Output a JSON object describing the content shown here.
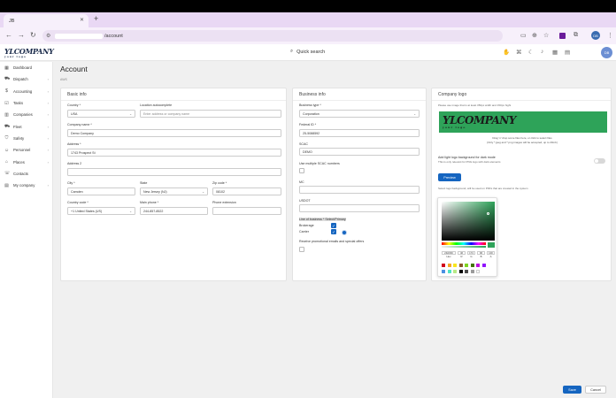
{
  "browser": {
    "tab_title": "JB",
    "url_path": "/account",
    "profile_initials": "DB"
  },
  "header": {
    "logo_main": "YLCOMPANY",
    "logo_sub": "your logo",
    "search_label": "Quick search",
    "avatar_initials": "DB"
  },
  "sidebar": {
    "items": [
      {
        "label": "Dashboard",
        "icon": "dashboard-icon",
        "chev": ""
      },
      {
        "label": "Dispatch",
        "icon": "truck-icon",
        "chev": "›"
      },
      {
        "label": "Accounting",
        "icon": "dollar-icon",
        "chev": "›"
      },
      {
        "label": "Tasks",
        "icon": "checklist-icon",
        "chev": "›"
      },
      {
        "label": "Companies",
        "icon": "building-icon",
        "chev": "›"
      },
      {
        "label": "Fleet",
        "icon": "fleet-icon",
        "chev": "›"
      },
      {
        "label": "Safety",
        "icon": "shield-icon",
        "chev": "›"
      },
      {
        "label": "Personnel",
        "icon": "people-icon",
        "chev": "›"
      },
      {
        "label": "Places",
        "icon": "place-icon",
        "chev": "›"
      },
      {
        "label": "Contacts",
        "icon": "contact-icon",
        "chev": ""
      },
      {
        "label": "My company",
        "icon": "company-icon",
        "chev": "›"
      }
    ]
  },
  "page": {
    "title": "Account",
    "subtitle": "AWS"
  },
  "basic_info": {
    "title": "Basic info",
    "country_label": "Country *",
    "country_value": "USA",
    "location_label": "Location autocomplete",
    "location_placeholder": "Enter address or company name",
    "company_name_label": "Company name *",
    "company_name_value": "Demo Company",
    "address_label": "Address *",
    "address_value": "1743 Prospect St",
    "address2_label": "Address 2",
    "city_label": "City *",
    "city_value": "Camden",
    "state_label": "State",
    "state_value": "New Jersey (NJ)",
    "zip_label": "Zip code *",
    "zip_value": "08102",
    "country_code_label": "Country code *",
    "country_code_value": "+1 United States (US)",
    "main_phone_label": "Main phone *",
    "main_phone_value": "244-857-8522",
    "phone_ext_label": "Phone extension"
  },
  "business_info": {
    "title": "Business info",
    "business_type_label": "Business type *",
    "business_type_value": "Corporation",
    "federal_id_label": "Federal ID *",
    "federal_id_value": "25-5088592",
    "scac_label": "SCAC",
    "scac_value": "DEMO",
    "multiple_scac_label": "Use multiple SCAC numbers",
    "mc_label": "MC",
    "usdot_label": "USDOT",
    "lob_label": "Line of business * Select/Primary",
    "lob_brokerage": "Brokerage",
    "lob_carrier": "Carrier",
    "promo_label": "Receive promotional emails and special offers"
  },
  "company_logo": {
    "title": "Company logo",
    "hint": "Please use image that is at least 350px width and 150px hight",
    "logo_main": "YLCOMPANY",
    "logo_sub": "your logo",
    "drop_text": "Drag 'n' drop some files here, or click to select files",
    "drop_subtext": "(Only *.jpeg and *.png images will be accepted, up to 20mb)",
    "dark_bg_label": "Add light logo background for dark mode",
    "dark_bg_sub": "This is only relevant for PNG logo with dark elements",
    "preview_label": "Preview",
    "bg_hint": "Select logo background, will be used on PDFs that are created in the system",
    "picker": {
      "hex": "2FA660",
      "r": "46",
      "g": "174",
      "b": "96",
      "a": "100",
      "hex_label": "Hex",
      "r_label": "R",
      "g_label": "G",
      "b_label": "B",
      "a_label": "A"
    },
    "swatches_row1": [
      "#d0021b",
      "#f5a623",
      "#f8e71c",
      "#8b572a",
      "#7ed321",
      "#417505",
      "#bd10e0",
      "#9013fe"
    ],
    "swatches_row2": [
      "#4a90e2",
      "#50e3c2",
      "#b8e986",
      "#000000",
      "#4a4a4a",
      "#9b9b9b",
      "#ffffff"
    ]
  },
  "footer": {
    "save_label": "Save",
    "cancel_label": "Cancel"
  },
  "colors": {
    "primary": "#1565c0",
    "logo_bg": "#2ea359"
  }
}
